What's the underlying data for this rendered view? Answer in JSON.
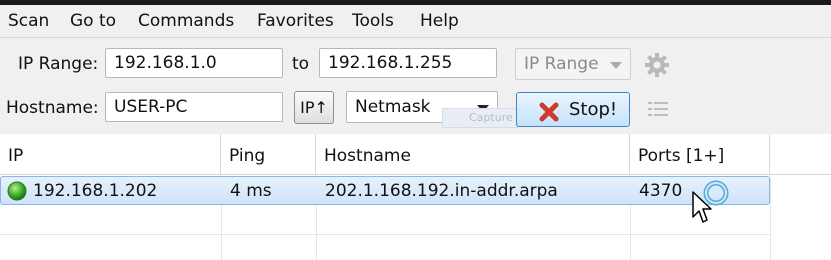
{
  "menu": {
    "items": [
      "Scan",
      "Go to",
      "Commands",
      "Favorites",
      "Tools",
      "Help"
    ]
  },
  "toolbar": {
    "ip_range_label": "IP Range:",
    "ip_start": "192.168.1.0",
    "to_label": "to",
    "ip_end": "192.168.1.255",
    "feeder_select": "IP Range",
    "hostname_label": "Hostname:",
    "hostname_value": "USER-PC",
    "ip_button": "IP↑",
    "netmask_select": "Netmask",
    "stop_button": "Stop!",
    "ghost_text": "Capture"
  },
  "table": {
    "columns": [
      "IP",
      "Ping",
      "Hostname",
      "Ports [1+]"
    ],
    "rows": [
      {
        "ip": "192.168.1.202",
        "ping": "4 ms",
        "hostname": "202.1.168.192.in-addr.arpa",
        "ports": "4370"
      }
    ]
  },
  "icons": {
    "settings": "gear-icon",
    "columns": "list-icon",
    "stop": "x-icon",
    "status": "green-dot-icon",
    "busy": "loading-ring-icon",
    "cursor": "mouse-pointer-icon"
  },
  "colors": {
    "stop_icon": "#d0392b",
    "row_highlight": "#cfe4fa",
    "status_alive": "#3fae2a"
  }
}
